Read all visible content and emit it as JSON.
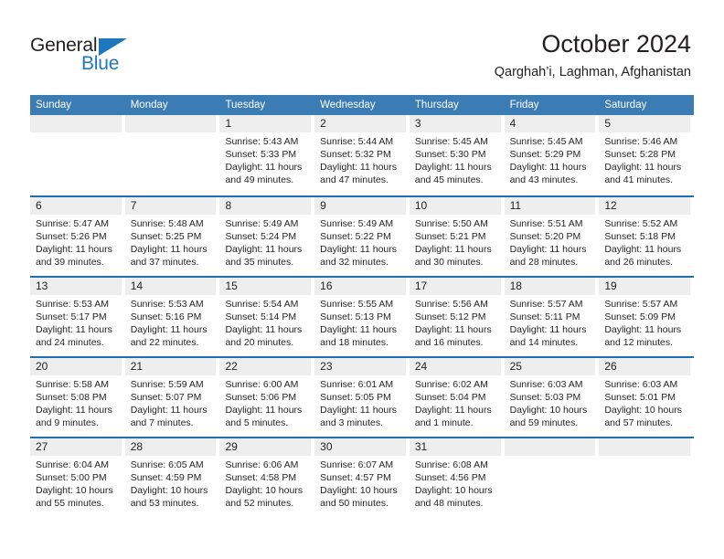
{
  "logo": {
    "text_top": "General",
    "text_bottom": "Blue",
    "triangle_icon": "triangle-icon",
    "color_dark": "#231f20",
    "color_blue": "#1f78be"
  },
  "header": {
    "title": "October 2024",
    "subtitle": "Qarghah’i, Laghman, Afghanistan"
  },
  "colors": {
    "header_row_bg": "#3b7cb5",
    "week_separator": "#1f6eb0",
    "day_band_bg": "#eeeeee",
    "text": "#231f20"
  },
  "weekdays": [
    "Sunday",
    "Monday",
    "Tuesday",
    "Wednesday",
    "Thursday",
    "Friday",
    "Saturday"
  ],
  "weeks": [
    [
      {
        "day": "",
        "sunrise": "",
        "sunset": "",
        "daylight": "",
        "empty": true
      },
      {
        "day": "",
        "sunrise": "",
        "sunset": "",
        "daylight": "",
        "empty": true
      },
      {
        "day": "1",
        "sunrise": "Sunrise: 5:43 AM",
        "sunset": "Sunset: 5:33 PM",
        "daylight": "Daylight: 11 hours and 49 minutes."
      },
      {
        "day": "2",
        "sunrise": "Sunrise: 5:44 AM",
        "sunset": "Sunset: 5:32 PM",
        "daylight": "Daylight: 11 hours and 47 minutes."
      },
      {
        "day": "3",
        "sunrise": "Sunrise: 5:45 AM",
        "sunset": "Sunset: 5:30 PM",
        "daylight": "Daylight: 11 hours and 45 minutes."
      },
      {
        "day": "4",
        "sunrise": "Sunrise: 5:45 AM",
        "sunset": "Sunset: 5:29 PM",
        "daylight": "Daylight: 11 hours and 43 minutes."
      },
      {
        "day": "5",
        "sunrise": "Sunrise: 5:46 AM",
        "sunset": "Sunset: 5:28 PM",
        "daylight": "Daylight: 11 hours and 41 minutes."
      }
    ],
    [
      {
        "day": "6",
        "sunrise": "Sunrise: 5:47 AM",
        "sunset": "Sunset: 5:26 PM",
        "daylight": "Daylight: 11 hours and 39 minutes."
      },
      {
        "day": "7",
        "sunrise": "Sunrise: 5:48 AM",
        "sunset": "Sunset: 5:25 PM",
        "daylight": "Daylight: 11 hours and 37 minutes."
      },
      {
        "day": "8",
        "sunrise": "Sunrise: 5:49 AM",
        "sunset": "Sunset: 5:24 PM",
        "daylight": "Daylight: 11 hours and 35 minutes."
      },
      {
        "day": "9",
        "sunrise": "Sunrise: 5:49 AM",
        "sunset": "Sunset: 5:22 PM",
        "daylight": "Daylight: 11 hours and 32 minutes."
      },
      {
        "day": "10",
        "sunrise": "Sunrise: 5:50 AM",
        "sunset": "Sunset: 5:21 PM",
        "daylight": "Daylight: 11 hours and 30 minutes."
      },
      {
        "day": "11",
        "sunrise": "Sunrise: 5:51 AM",
        "sunset": "Sunset: 5:20 PM",
        "daylight": "Daylight: 11 hours and 28 minutes."
      },
      {
        "day": "12",
        "sunrise": "Sunrise: 5:52 AM",
        "sunset": "Sunset: 5:18 PM",
        "daylight": "Daylight: 11 hours and 26 minutes."
      }
    ],
    [
      {
        "day": "13",
        "sunrise": "Sunrise: 5:53 AM",
        "sunset": "Sunset: 5:17 PM",
        "daylight": "Daylight: 11 hours and 24 minutes."
      },
      {
        "day": "14",
        "sunrise": "Sunrise: 5:53 AM",
        "sunset": "Sunset: 5:16 PM",
        "daylight": "Daylight: 11 hours and 22 minutes."
      },
      {
        "day": "15",
        "sunrise": "Sunrise: 5:54 AM",
        "sunset": "Sunset: 5:14 PM",
        "daylight": "Daylight: 11 hours and 20 minutes."
      },
      {
        "day": "16",
        "sunrise": "Sunrise: 5:55 AM",
        "sunset": "Sunset: 5:13 PM",
        "daylight": "Daylight: 11 hours and 18 minutes."
      },
      {
        "day": "17",
        "sunrise": "Sunrise: 5:56 AM",
        "sunset": "Sunset: 5:12 PM",
        "daylight": "Daylight: 11 hours and 16 minutes."
      },
      {
        "day": "18",
        "sunrise": "Sunrise: 5:57 AM",
        "sunset": "Sunset: 5:11 PM",
        "daylight": "Daylight: 11 hours and 14 minutes."
      },
      {
        "day": "19",
        "sunrise": "Sunrise: 5:57 AM",
        "sunset": "Sunset: 5:09 PM",
        "daylight": "Daylight: 11 hours and 12 minutes."
      }
    ],
    [
      {
        "day": "20",
        "sunrise": "Sunrise: 5:58 AM",
        "sunset": "Sunset: 5:08 PM",
        "daylight": "Daylight: 11 hours and 9 minutes."
      },
      {
        "day": "21",
        "sunrise": "Sunrise: 5:59 AM",
        "sunset": "Sunset: 5:07 PM",
        "daylight": "Daylight: 11 hours and 7 minutes."
      },
      {
        "day": "22",
        "sunrise": "Sunrise: 6:00 AM",
        "sunset": "Sunset: 5:06 PM",
        "daylight": "Daylight: 11 hours and 5 minutes."
      },
      {
        "day": "23",
        "sunrise": "Sunrise: 6:01 AM",
        "sunset": "Sunset: 5:05 PM",
        "daylight": "Daylight: 11 hours and 3 minutes."
      },
      {
        "day": "24",
        "sunrise": "Sunrise: 6:02 AM",
        "sunset": "Sunset: 5:04 PM",
        "daylight": "Daylight: 11 hours and 1 minute."
      },
      {
        "day": "25",
        "sunrise": "Sunrise: 6:03 AM",
        "sunset": "Sunset: 5:03 PM",
        "daylight": "Daylight: 10 hours and 59 minutes."
      },
      {
        "day": "26",
        "sunrise": "Sunrise: 6:03 AM",
        "sunset": "Sunset: 5:01 PM",
        "daylight": "Daylight: 10 hours and 57 minutes."
      }
    ],
    [
      {
        "day": "27",
        "sunrise": "Sunrise: 6:04 AM",
        "sunset": "Sunset: 5:00 PM",
        "daylight": "Daylight: 10 hours and 55 minutes."
      },
      {
        "day": "28",
        "sunrise": "Sunrise: 6:05 AM",
        "sunset": "Sunset: 4:59 PM",
        "daylight": "Daylight: 10 hours and 53 minutes."
      },
      {
        "day": "29",
        "sunrise": "Sunrise: 6:06 AM",
        "sunset": "Sunset: 4:58 PM",
        "daylight": "Daylight: 10 hours and 52 minutes."
      },
      {
        "day": "30",
        "sunrise": "Sunrise: 6:07 AM",
        "sunset": "Sunset: 4:57 PM",
        "daylight": "Daylight: 10 hours and 50 minutes."
      },
      {
        "day": "31",
        "sunrise": "Sunrise: 6:08 AM",
        "sunset": "Sunset: 4:56 PM",
        "daylight": "Daylight: 10 hours and 48 minutes."
      },
      {
        "day": "",
        "sunrise": "",
        "sunset": "",
        "daylight": "",
        "empty": true
      },
      {
        "day": "",
        "sunrise": "",
        "sunset": "",
        "daylight": "",
        "empty": true
      }
    ]
  ]
}
